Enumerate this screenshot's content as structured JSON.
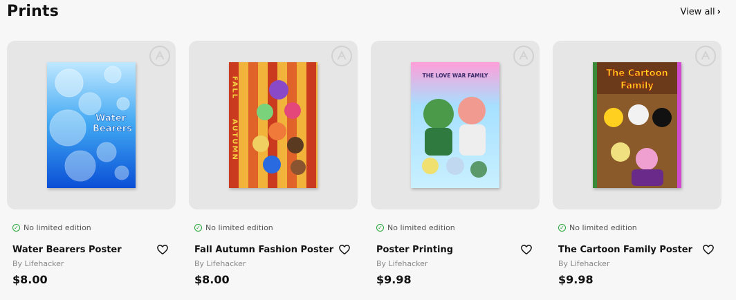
{
  "section": {
    "title": "Prints",
    "view_all": "View all",
    "view_all_chevron": "›"
  },
  "products": [
    {
      "name": "Water Bearers Poster",
      "edition": "No limited edition",
      "by": "By Lifehacker",
      "price": "$8.00",
      "poster_text": [
        "Water",
        "Bearers"
      ],
      "poster_icon": "poster-water-bearers-image"
    },
    {
      "name": "Fall Autumn Fashion Poster",
      "edition": "No limited edition",
      "by": "By Lifehacker",
      "price": "$8.00",
      "poster_text": [
        "FALL",
        "AUTUMN"
      ],
      "poster_icon": "poster-fall-autumn-image"
    },
    {
      "name": "Poster Printing",
      "edition": "No limited edition",
      "by": "By Lifehacker",
      "price": "$9.98",
      "poster_text": [
        "THE LOVE WAR FAMILY"
      ],
      "poster_icon": "poster-love-war-family-image"
    },
    {
      "name": "The Cartoon Family Poster",
      "edition": "No limited edition",
      "by": "By Lifehacker",
      "price": "$9.98",
      "poster_text": [
        "The Cartoon",
        "Family"
      ],
      "poster_icon": "poster-cartoon-family-image"
    }
  ],
  "colors": {
    "check_green": "#2aa63a",
    "card_bg": "#e6e6e6",
    "page_bg": "#f7f7f7"
  }
}
